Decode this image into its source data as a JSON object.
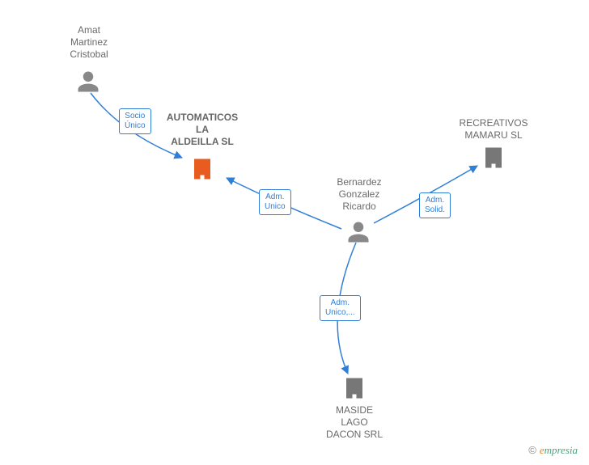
{
  "nodes": {
    "amat": {
      "label": "Amat\nMartinez\nCristobal",
      "type": "person"
    },
    "automaticos": {
      "label": "AUTOMATICOS\nLA\nALDEILLA SL",
      "type": "company",
      "focal": true
    },
    "bernardez": {
      "label": "Bernardez\nGonzalez\nRicardo",
      "type": "person"
    },
    "recreativos": {
      "label": "RECREATIVOS\nMAMARU SL",
      "type": "company"
    },
    "maside": {
      "label": "MASIDE\nLAGO\nDACON SRL",
      "type": "company"
    }
  },
  "edges": {
    "socio_unico": {
      "label": "Socio\nÚnico"
    },
    "adm_unico_1": {
      "label": "Adm.\nUnico"
    },
    "adm_solid": {
      "label": "Adm.\nSolid."
    },
    "adm_unico_2": {
      "label": "Adm.\nUnico,..."
    }
  },
  "colors": {
    "person_fill": "#888888",
    "company_fill": "#777777",
    "focal_fill": "#e85c1f",
    "edge_stroke": "#2f7ed8"
  },
  "watermark": {
    "copyright": "©",
    "e": "e",
    "rest": "mpresia"
  }
}
